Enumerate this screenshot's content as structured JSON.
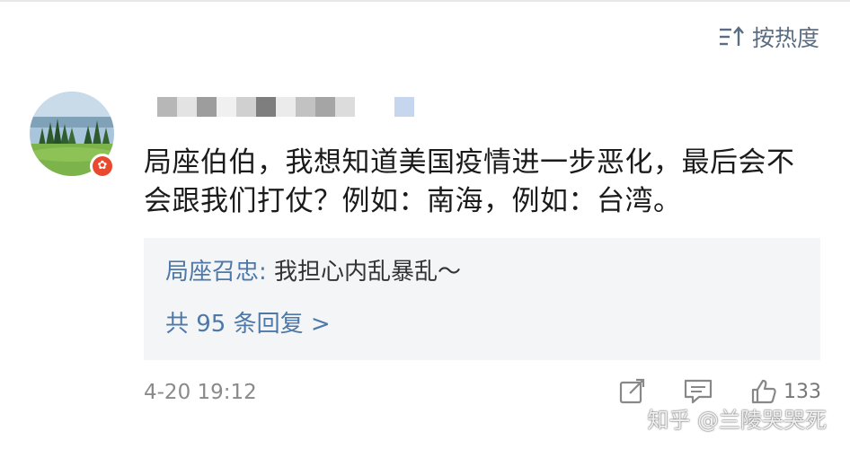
{
  "sort": {
    "label": "按热度",
    "icon": "sort-icon"
  },
  "comment": {
    "avatar_icon": "avatar-landscape",
    "badge_icon": "hongkong-flag-badge",
    "badge_glyph": "✿",
    "text": "局座伯伯，我想知道美国疫情进一步恶化，最后会不会跟我们打仗？例如：南海，例如：台湾。"
  },
  "replies": {
    "author": "局座召忠:",
    "preview": " 我担心内乱暴乱～",
    "count_label": "共 95 条回复 >"
  },
  "footer": {
    "time": "4-20 19:12",
    "like_count": "133",
    "share_icon": "share-icon",
    "comment_icon": "comment-icon",
    "like_icon": "thumbs-up-icon"
  },
  "watermark": "知乎 @兰陵哭哭死",
  "colors": {
    "accent": "#4d78a8",
    "reply_bg": "#f4f5f7",
    "badge": "#e8492f"
  }
}
